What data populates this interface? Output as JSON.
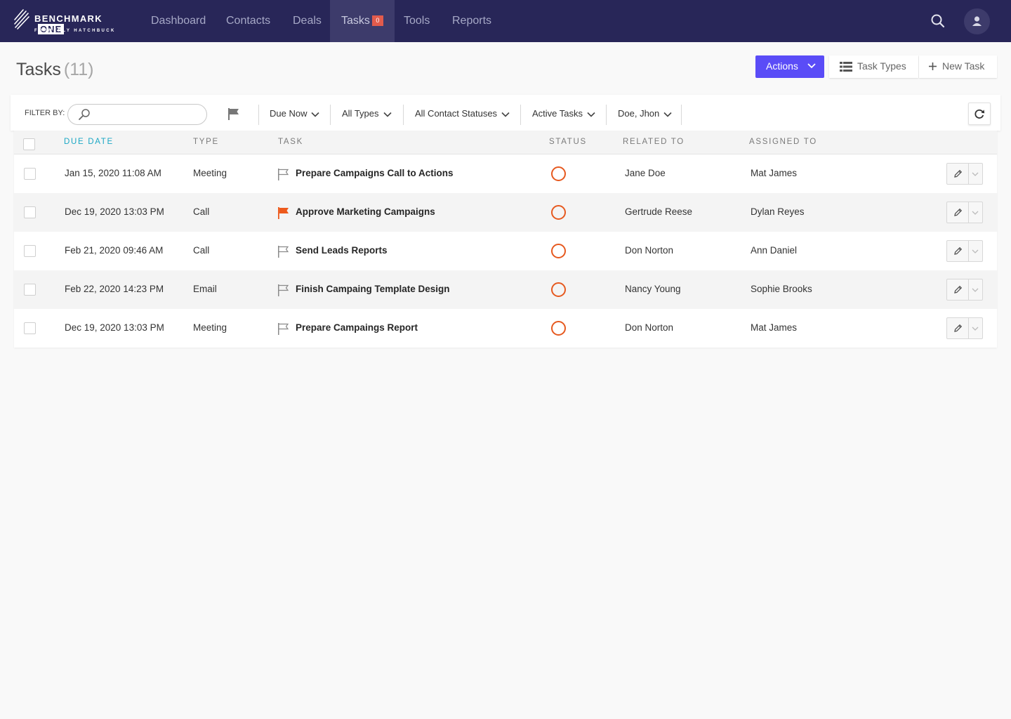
{
  "brand": {
    "name": "BENCHMARK",
    "suffix": "ONE",
    "tagline": "FORMERLY HATCHBUCK"
  },
  "nav": {
    "items": [
      {
        "label": "Dashboard"
      },
      {
        "label": "Contacts"
      },
      {
        "label": "Deals"
      },
      {
        "label": "Tasks",
        "badge": "0",
        "active": true
      },
      {
        "label": "Tools"
      },
      {
        "label": "Reports"
      }
    ]
  },
  "header": {
    "title": "Tasks",
    "count": "(11)",
    "actions_label": "Actions",
    "task_types_label": "Task Types",
    "new_task_label": "New Task"
  },
  "filters": {
    "label": "FILTER BY:",
    "search_value": "",
    "due": "Due Now",
    "types": "All Types",
    "contact_statuses": "All Contact Statuses",
    "task_state": "Active Tasks",
    "assignee": "Doe, Jhon"
  },
  "table": {
    "columns": {
      "due_date": "DUE DATE",
      "type": "TYPE",
      "task": "TASK",
      "status": "STATUS",
      "related_to": "RELATED TO",
      "assigned_to": "ASSIGNED TO"
    },
    "rows": [
      {
        "due": "Jan 15, 2020 11:08 AM",
        "type": "Meeting",
        "task": "Prepare Campaigns Call to Actions",
        "flagged": false,
        "related": "Jane Doe",
        "assigned": "Mat James"
      },
      {
        "due": "Dec 19, 2020 13:03 PM",
        "type": "Call",
        "task": "Approve Marketing Campaigns",
        "flagged": true,
        "related": "Gertrude Reese",
        "assigned": "Dylan Reyes"
      },
      {
        "due": "Feb 21, 2020 09:46 AM",
        "type": "Call",
        "task": "Send Leads Reports",
        "flagged": false,
        "related": "Don Norton",
        "assigned": "Ann Daniel"
      },
      {
        "due": "Feb 22, 2020 14:23 PM",
        "type": "Email",
        "task": "Finish Campaing Template Design",
        "flagged": false,
        "related": "Nancy Young",
        "assigned": "Sophie Brooks"
      },
      {
        "due": "Dec 19, 2020 13:03 PM",
        "type": "Meeting",
        "task": "Prepare Campaings Report",
        "flagged": false,
        "related": "Don Norton",
        "assigned": "Mat James"
      }
    ]
  },
  "colors": {
    "nav_bg": "#282658",
    "accent_button": "#5a4cf7",
    "sorted_header": "#1ba8c5",
    "status_ring": "#e6591f",
    "flag_active": "#ed5a1c",
    "badge": "#e25b4c"
  },
  "icons": {
    "search": "search-icon",
    "user": "user-icon",
    "chevron": "chevron-down-icon",
    "list": "list-icon",
    "plus": "plus-icon",
    "flag": "flag-icon",
    "refresh": "refresh-icon",
    "edit": "pencil-icon"
  }
}
